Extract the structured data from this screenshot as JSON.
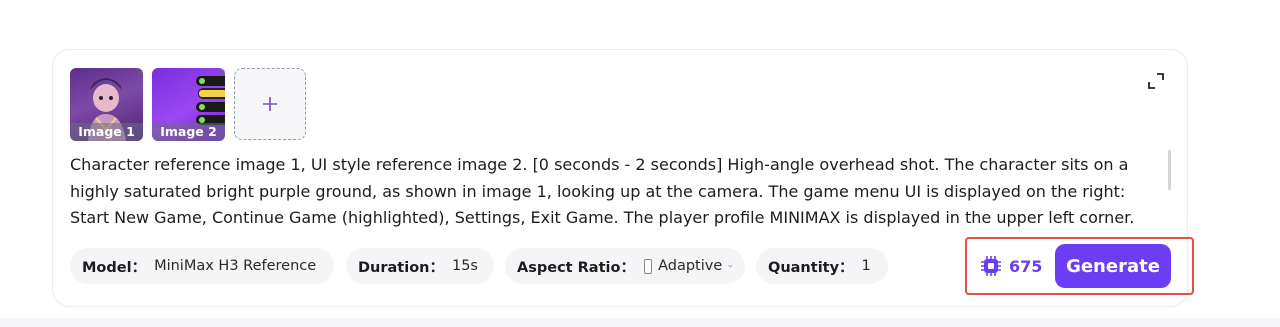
{
  "images": [
    {
      "label": "Image 1",
      "close": "×",
      "icon": "character-thumbnail"
    },
    {
      "label": "Image 2",
      "close": "×",
      "icon": "ui-menu-thumbnail"
    }
  ],
  "add_image": {
    "icon": "plus-icon",
    "symbol": "+"
  },
  "expand": {
    "icon": "expand-icon"
  },
  "prompt": {
    "text": "Character reference image 1, UI style reference image 2. [0 seconds - 2 seconds] High-angle overhead shot. The character sits on a highly saturated bright purple ground, as shown in image 1, looking up at the camera. The game menu UI is displayed on the right: Start New Game, Continue Game (highlighted), Settings, Exit Game. The player profile MINIMAX is displayed in the upper left corner. Click"
  },
  "options": {
    "model": {
      "label": "Model：",
      "value": "MiniMax H3 Reference"
    },
    "duration": {
      "label": "Duration：",
      "value": "15s"
    },
    "aspect_ratio": {
      "label": "Aspect Ratio：",
      "value": "Adaptive",
      "checked": false
    },
    "quantity": {
      "label": "Quantity：",
      "value": "1"
    }
  },
  "credits": {
    "value": "675",
    "icon": "credit-chip-icon"
  },
  "generate": {
    "label": "Generate"
  },
  "colors": {
    "accent": "#6c3df4",
    "highlight_border": "#e2504a",
    "pill_bg": "#f5f5f7"
  }
}
